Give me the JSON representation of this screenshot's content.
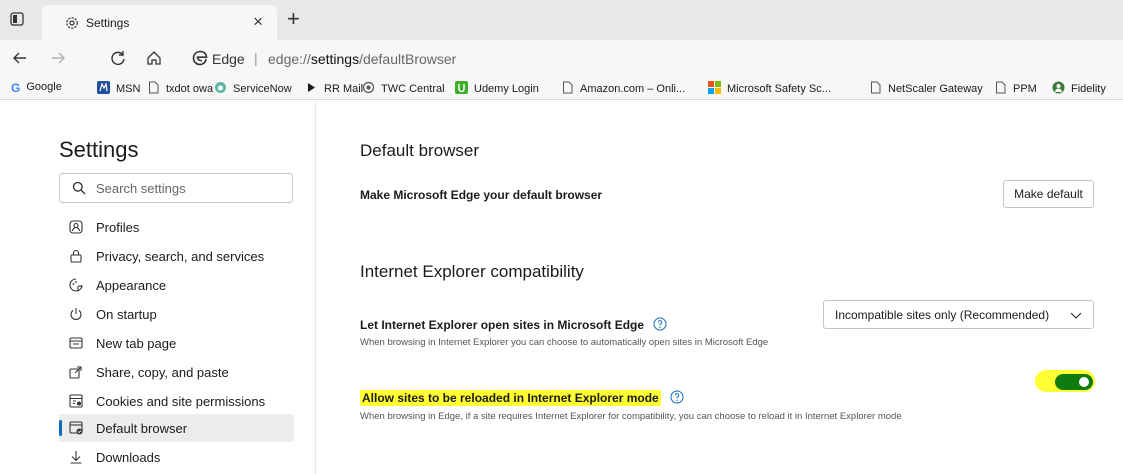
{
  "tab": {
    "title": "Settings",
    "close": "×",
    "new_tab": "+"
  },
  "address": {
    "site": "Edge",
    "separator": "|",
    "url_prefix": "edge://",
    "url_path": "settings",
    "url_suffix": "/defaultBrowser"
  },
  "favorites": [
    {
      "label": "Google",
      "icon": "google-icon",
      "color": "#4285f4"
    },
    {
      "label": "MSN",
      "icon": "msn-icon",
      "color": "#1f4e9c"
    },
    {
      "label": "txdot owa",
      "icon": "page-icon",
      "color": "#555555"
    },
    {
      "label": "ServiceNow",
      "icon": "servicenow-icon",
      "color": "#62b6a6"
    },
    {
      "label": "RR Mail",
      "icon": "play-icon",
      "color": "#1b1b1b"
    },
    {
      "label": "TWC Central",
      "icon": "twc-icon",
      "color": "#555555"
    },
    {
      "label": "Udemy Login",
      "icon": "udemy-icon",
      "color": "#3fae2a"
    },
    {
      "label": "Amazon.com – Onli...",
      "icon": "page-icon",
      "color": "#555555"
    },
    {
      "label": "Microsoft Safety Sc...",
      "icon": "microsoft-icon",
      "color": "#f25022"
    },
    {
      "label": "NetScaler Gateway",
      "icon": "page-icon",
      "color": "#555555"
    },
    {
      "label": "PPM",
      "icon": "page-icon",
      "color": "#555555"
    },
    {
      "label": "Fidelity",
      "icon": "fidelity-icon",
      "color": "#3d7a3a"
    }
  ],
  "sidebar": {
    "title": "Settings",
    "search_placeholder": "Search settings",
    "items": [
      {
        "label": "Profiles",
        "icon": "profile-icon"
      },
      {
        "label": "Privacy, search, and services",
        "icon": "lock-icon"
      },
      {
        "label": "Appearance",
        "icon": "appearance-icon"
      },
      {
        "label": "On startup",
        "icon": "power-icon"
      },
      {
        "label": "New tab page",
        "icon": "new-tab-icon"
      },
      {
        "label": "Share, copy, and paste",
        "icon": "share-icon"
      },
      {
        "label": "Cookies and site permissions",
        "icon": "cookies-icon"
      },
      {
        "label": "Default browser",
        "icon": "default-browser-icon",
        "active": true
      },
      {
        "label": "Downloads",
        "icon": "download-icon"
      }
    ]
  },
  "main": {
    "default_browser": {
      "heading": "Default browser",
      "label": "Make Microsoft Edge your default browser",
      "button": "Make default"
    },
    "ie_compat": {
      "heading": "Internet Explorer compatibility",
      "open_sites_label": "Let Internet Explorer open sites in Microsoft Edge",
      "open_sites_desc": "When browsing in Internet Explorer you can choose to automatically open sites in Microsoft Edge",
      "open_sites_value": "Incompatible sites only (Recommended)",
      "reload_label": "Allow sites to be reloaded in Internet Explorer mode",
      "reload_desc": "When browsing in Edge, if a site requires Internet Explorer for compatibility, you can choose to reload it in Internet Explorer mode",
      "reload_enabled": true
    }
  },
  "colors": {
    "accent": "#0f6cbd",
    "toggle_on": "#107c10",
    "highlight": "#ffff33"
  }
}
